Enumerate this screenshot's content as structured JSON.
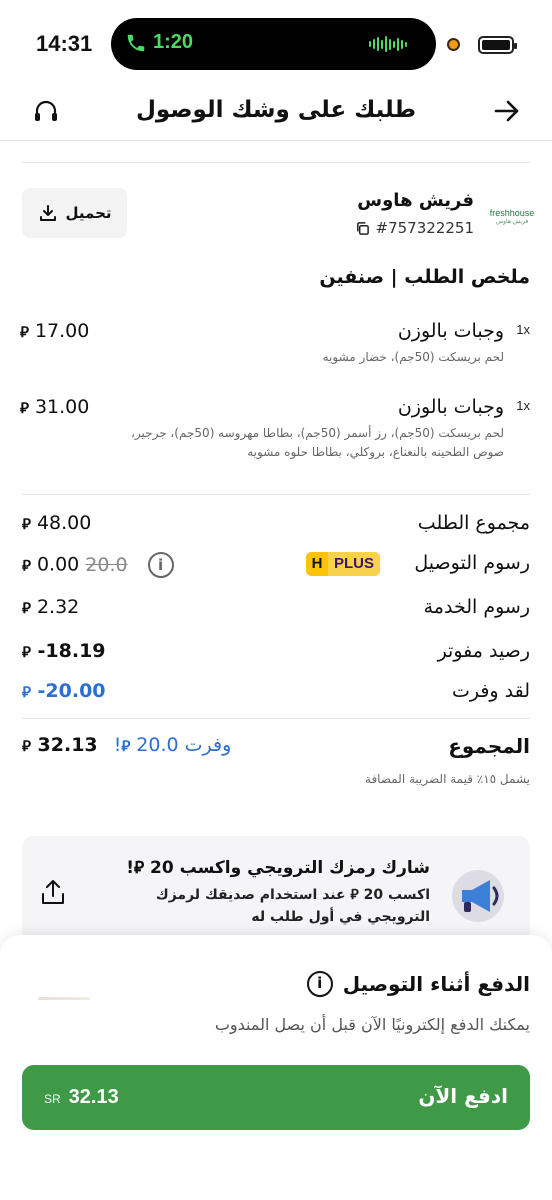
{
  "status_bar": {
    "time": "14:31",
    "call_duration": "1:20"
  },
  "header": {
    "title": "طلبك على وشك الوصول"
  },
  "restaurant": {
    "name": "فريش هاوس",
    "order_id": "#757322251",
    "logo_text": "freshhouse",
    "logo_subtext": "فريش هاوس",
    "download_label": "تحميل"
  },
  "summary": {
    "title": "ملخص الطلب | صنفين",
    "items": [
      {
        "qty": "1x",
        "name": "وجبات بالوزن",
        "price": "17.00",
        "description": "لحم بريسكت (50جم)، خضار مشويه"
      },
      {
        "qty": "1x",
        "name": "وجبات بالوزن",
        "price": "31.00",
        "description": "لحم بريسكت (50جم)، رز أسمر (50جم)، بطاطا مهروسه (50جم)، جرجير، صوص الطحينه بالنعناع، بروكلي، بطاطا حلوه مشويه"
      }
    ]
  },
  "totals": {
    "subtotal_label": "مجموع الطلب",
    "subtotal_value": "48.00",
    "delivery_label": "رسوم التوصيل",
    "delivery_value": "0.00",
    "delivery_original": "20.0",
    "plus_badge": "PLUS",
    "plus_letter": "H",
    "info_symbol": "i",
    "service_label": "رسوم الخدمة",
    "service_value": "2.32",
    "wallet_label": "رصيد مفوتر",
    "wallet_value": "-18.19",
    "saved_label": "لقد وفرت",
    "saved_value": "-20.00",
    "total_label": "المجموع",
    "total_value": "32.13",
    "total_saved_prefix": "وفرت",
    "total_saved_amount": "20.0",
    "total_saved_suffix": "!",
    "vat_note": "يشمل ١٥٪ قيمة الضريبة المضافة"
  },
  "referral": {
    "title": "شارك رمزك الترويجي واكسب 20 ⃁!",
    "description": "اكسب 20 ⃁ عند استخدام صديقك لرمزك الترويجي في أول طلب له"
  },
  "payment_sheet": {
    "title": "الدفع أثناء التوصيل",
    "description": "يمكنك الدفع إلكترونيًا الآن قبل أن يصل المندوب",
    "button_label": "ادفع الآن",
    "currency": "SR",
    "amount": "32.13"
  },
  "currency_symbol": "⃁",
  "colors": {
    "accent_green": "#3e9a47",
    "link_blue": "#2d6ed3",
    "plus_yellow": "#fcc30b"
  }
}
